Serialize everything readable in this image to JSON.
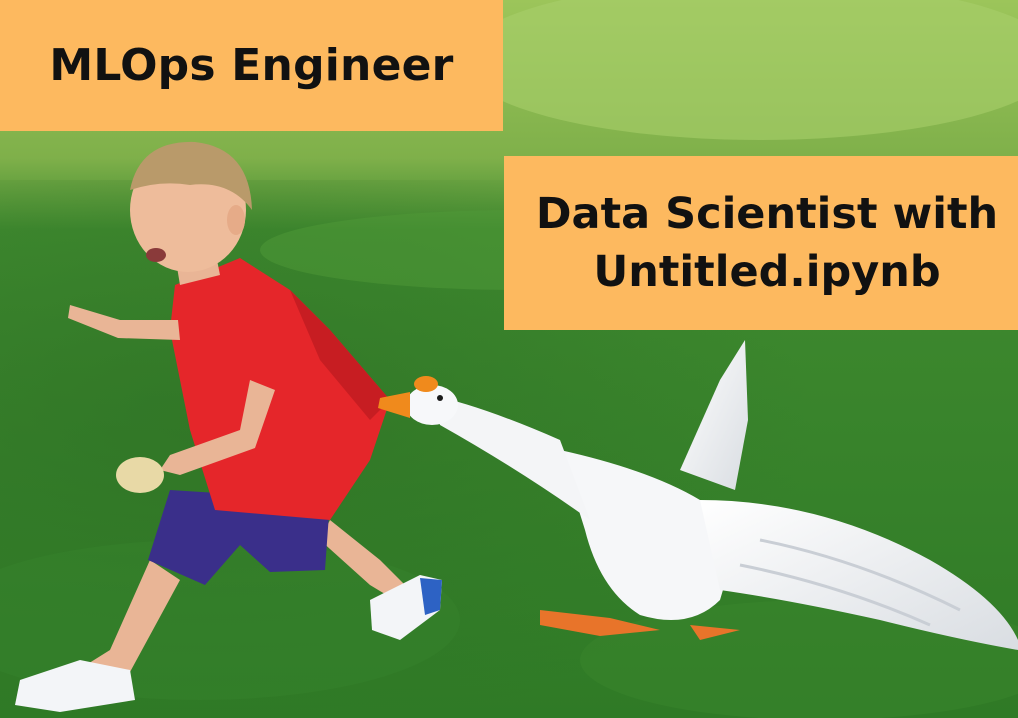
{
  "meme": {
    "top_caption": "MLOps Engineer",
    "right_caption_line1": "Data Scientist with",
    "right_caption_line2": "Untitled.ipynb",
    "caption_background": "#fdb95f",
    "caption_text_color": "#111111"
  },
  "scene": {
    "subject_1": "boy-in-red-shirt-running",
    "subject_2": "white-goose-biting-shirt",
    "setting": "grass-field"
  }
}
